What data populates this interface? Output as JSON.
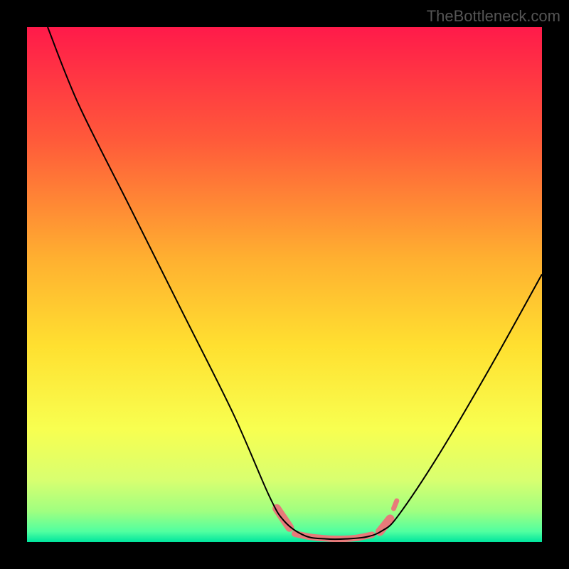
{
  "watermark": "TheBottleneck.com",
  "chart_data": {
    "type": "line",
    "title": "",
    "xlabel": "",
    "ylabel": "",
    "xlim": [
      0,
      100
    ],
    "ylim": [
      0,
      100
    ],
    "gradient_stops": [
      {
        "offset": 0,
        "color": "#ff1a4a"
      },
      {
        "offset": 22,
        "color": "#ff5a3a"
      },
      {
        "offset": 45,
        "color": "#ffb030"
      },
      {
        "offset": 62,
        "color": "#ffe030"
      },
      {
        "offset": 78,
        "color": "#f8ff50"
      },
      {
        "offset": 88,
        "color": "#d8ff70"
      },
      {
        "offset": 94,
        "color": "#a0ff80"
      },
      {
        "offset": 98,
        "color": "#50ffa0"
      },
      {
        "offset": 100,
        "color": "#00e59e"
      }
    ],
    "series": [
      {
        "name": "curve",
        "color": "#000000",
        "points": [
          {
            "x": 4,
            "y": 100
          },
          {
            "x": 10,
            "y": 85
          },
          {
            "x": 20,
            "y": 65
          },
          {
            "x": 30,
            "y": 45
          },
          {
            "x": 40,
            "y": 25
          },
          {
            "x": 47,
            "y": 9
          },
          {
            "x": 50,
            "y": 4
          },
          {
            "x": 54,
            "y": 1.2
          },
          {
            "x": 58,
            "y": 0.6
          },
          {
            "x": 62,
            "y": 0.6
          },
          {
            "x": 66,
            "y": 1.0
          },
          {
            "x": 69,
            "y": 2.2
          },
          {
            "x": 72,
            "y": 5
          },
          {
            "x": 80,
            "y": 17
          },
          {
            "x": 90,
            "y": 34
          },
          {
            "x": 100,
            "y": 52
          }
        ]
      }
    ],
    "highlight_segments": [
      {
        "name": "left-tail",
        "color": "#e77a7a",
        "width": 12,
        "points": [
          {
            "x": 48.5,
            "y": 6.5
          },
          {
            "x": 51,
            "y": 2.8
          }
        ]
      },
      {
        "name": "flat-bottom",
        "color": "#e77a7a",
        "width": 9,
        "points": [
          {
            "x": 52,
            "y": 1.6
          },
          {
            "x": 55,
            "y": 1.0
          },
          {
            "x": 58,
            "y": 0.7
          },
          {
            "x": 61,
            "y": 0.6
          },
          {
            "x": 64,
            "y": 0.8
          },
          {
            "x": 67,
            "y": 1.4
          }
        ]
      },
      {
        "name": "right-tail",
        "color": "#e77a7a",
        "width": 12,
        "points": [
          {
            "x": 68.5,
            "y": 2.0
          },
          {
            "x": 70.5,
            "y": 4.5
          }
        ]
      },
      {
        "name": "right-blob",
        "color": "#e77a7a",
        "width": 7,
        "points": [
          {
            "x": 71.2,
            "y": 6.5
          },
          {
            "x": 71.8,
            "y": 8.0
          }
        ]
      }
    ]
  }
}
